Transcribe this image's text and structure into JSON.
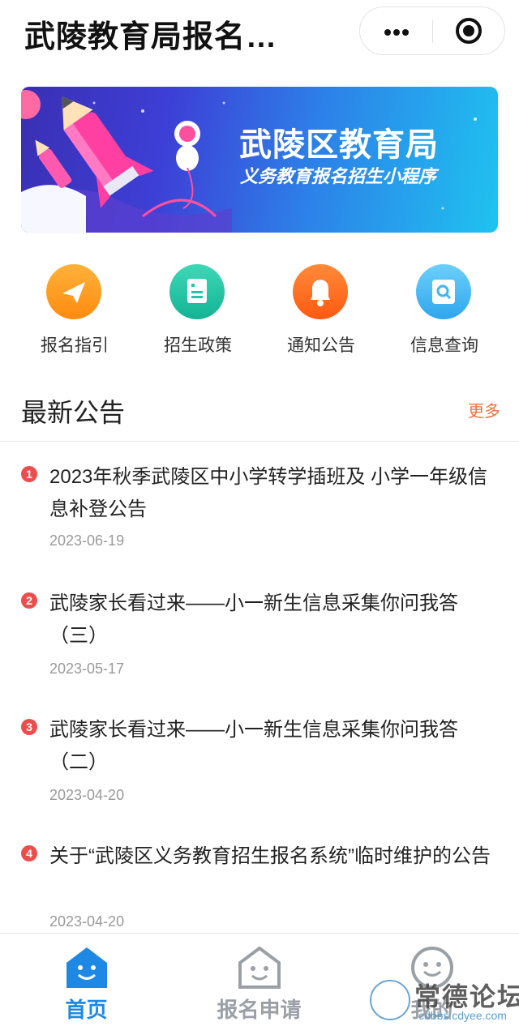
{
  "header": {
    "title": "武陵教育局报名…"
  },
  "banner": {
    "title": "武陵区教育局",
    "subtitle": "义务教育报名招生小程序"
  },
  "menu": [
    {
      "label": "报名指引",
      "icon": "paper-plane-icon",
      "color": "#ff9a1f"
    },
    {
      "label": "招生政策",
      "icon": "document-icon",
      "color": "#20c6a7"
    },
    {
      "label": "通知公告",
      "icon": "bell-icon",
      "color": "#ff6a1e"
    },
    {
      "label": "信息查询",
      "icon": "search-icon",
      "color": "#3fb6f2"
    }
  ],
  "notices_section": {
    "title": "最新公告",
    "more": "更多"
  },
  "notices": [
    {
      "num": "1",
      "title": "2023年秋季武陵区中小学转学插班及 小学一年级信息补登公告",
      "date": "2023-06-19"
    },
    {
      "num": "2",
      "title": "武陵家长看过来——小一新生信息采集你问我答（三）",
      "date": "2023-05-17"
    },
    {
      "num": "3",
      "title": "武陵家长看过来——小一新生信息采集你问我答（二）",
      "date": "2023-04-20"
    },
    {
      "num": "4",
      "title": "关于“武陵区义务教育招生报名系统”临时维护的公告",
      "date": "2023-04-20"
    }
  ],
  "tabbar": [
    {
      "label": "首页",
      "icon": "home-icon",
      "active": true
    },
    {
      "label": "报名申请",
      "icon": "apply-house-icon",
      "active": false
    },
    {
      "label": "我的",
      "icon": "profile-smile-icon",
      "active": false
    }
  ],
  "colors": {
    "accent": "#1e88e5",
    "inactive": "#9aa0a6",
    "more_link": "#f07040",
    "badge": "#ee4d4d"
  },
  "watermark": {
    "text": "常德论坛",
    "url": "cdbbs.cdyee.com"
  }
}
